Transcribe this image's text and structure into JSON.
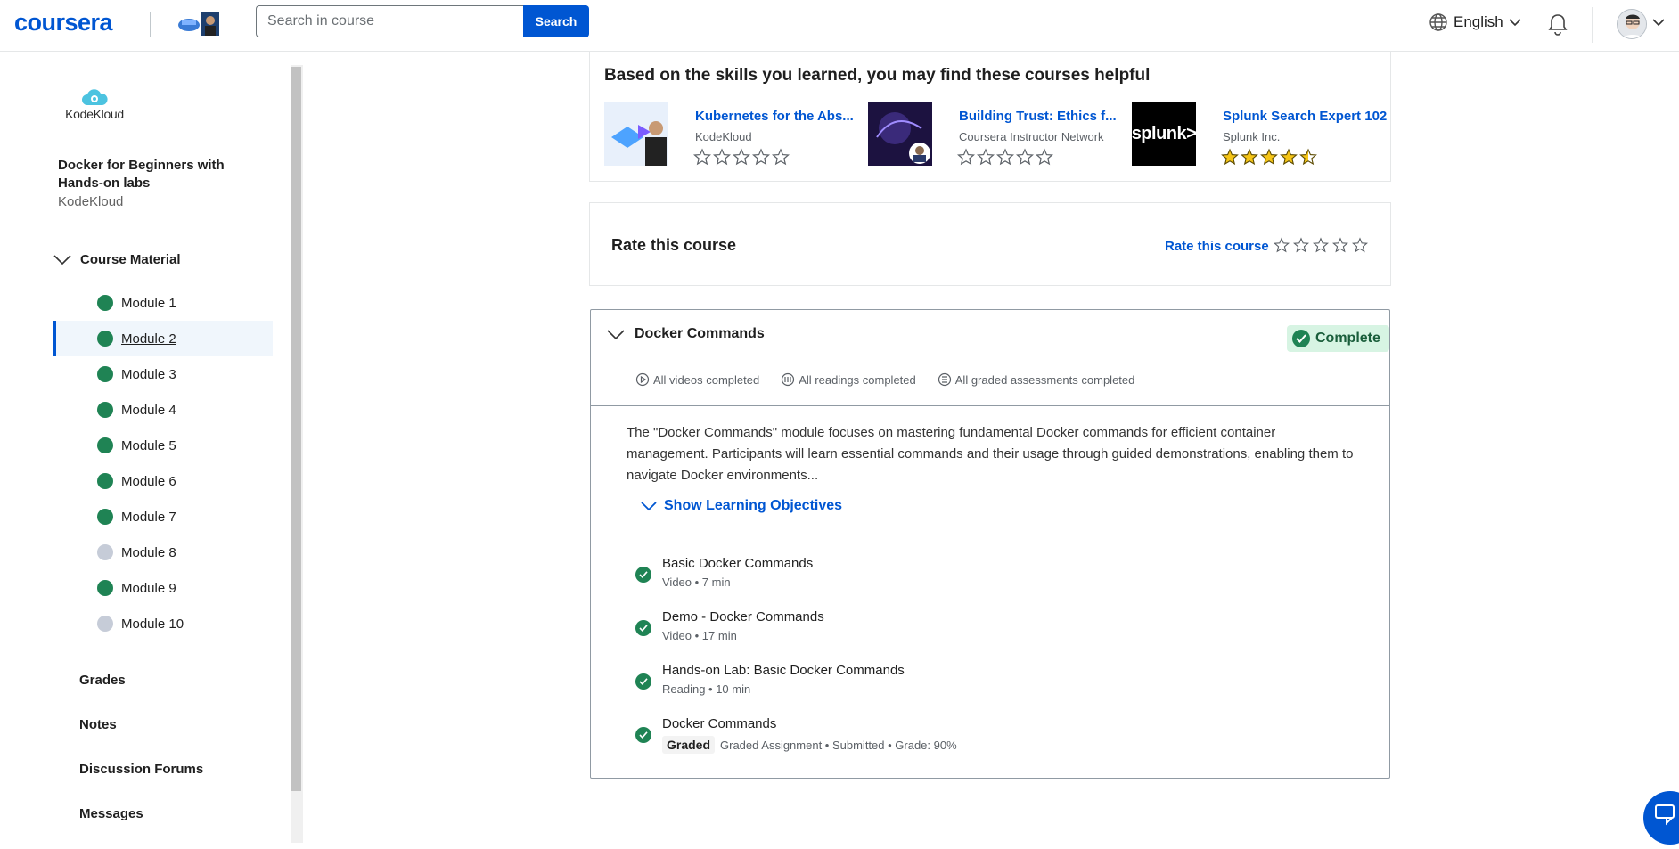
{
  "header": {
    "logo": "coursera",
    "search_placeholder": "Search in course",
    "search_button": "Search",
    "language": "English"
  },
  "sidebar": {
    "partner_logo": "KodeKloud",
    "course_title": "Docker for Beginners with Hands-on labs",
    "course_partner": "KodeKloud",
    "section_label": "Course Material",
    "modules": [
      {
        "label": "Module 1",
        "status": "complete"
      },
      {
        "label": "Module 2",
        "status": "complete",
        "active": true
      },
      {
        "label": "Module 3",
        "status": "complete"
      },
      {
        "label": "Module 4",
        "status": "complete"
      },
      {
        "label": "Module 5",
        "status": "complete"
      },
      {
        "label": "Module 6",
        "status": "complete"
      },
      {
        "label": "Module 7",
        "status": "complete"
      },
      {
        "label": "Module 8",
        "status": "incomplete"
      },
      {
        "label": "Module 9",
        "status": "complete"
      },
      {
        "label": "Module 10",
        "status": "incomplete"
      }
    ],
    "links": [
      "Grades",
      "Notes",
      "Discussion Forums",
      "Messages"
    ]
  },
  "recommendations": {
    "title": "Based on the skills you learned, you may find these courses helpful",
    "courses": [
      {
        "name": "Kubernetes for the Abs...",
        "org": "KodeKloud",
        "rating": 0
      },
      {
        "name": "Building Trust: Ethics f...",
        "org": "Coursera Instructor Network",
        "rating": 0
      },
      {
        "name": "Splunk Search Expert 102",
        "org": "Splunk Inc.",
        "rating": 4.5,
        "logo_text": "splunk>"
      }
    ]
  },
  "rate": {
    "title": "Rate this course",
    "link": "Rate this course"
  },
  "module_card": {
    "title": "Docker Commands",
    "status": "Complete",
    "stats": [
      "All videos completed",
      "All readings completed",
      "All graded assessments completed"
    ],
    "description": "The \"Docker Commands\" module focuses on mastering fundamental Docker commands for efficient container management. Participants will learn essential commands and their usage through guided demonstrations, enabling them to navigate Docker environments...",
    "objectives_label": "Show Learning Objectives",
    "items": [
      {
        "name": "Basic Docker Commands",
        "meta": "Video • 7 min"
      },
      {
        "name": "Demo - Docker Commands",
        "meta": "Video • 17 min"
      },
      {
        "name": "Hands-on Lab: Basic Docker Commands",
        "meta": "Reading • 10 min"
      },
      {
        "name": "Docker Commands",
        "badge": "Graded",
        "meta": "Graded Assignment • Submitted • Grade: 90%"
      }
    ]
  },
  "colors": {
    "brand": "#0056d2",
    "complete_green": "#1f8354",
    "complete_bg": "#d7f4e3",
    "incomplete_grey": "#c6ccd8",
    "star_gold": "#f5c518"
  }
}
